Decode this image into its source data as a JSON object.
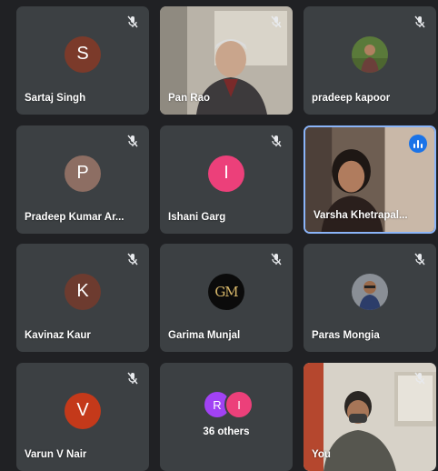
{
  "participants": [
    {
      "name": "Sartaj Singh",
      "initial": "S",
      "avatar_color": "#7b3a2a",
      "muted": true
    },
    {
      "name": "Pan Rao",
      "muted": true,
      "video": true
    },
    {
      "name": "pradeep kapoor",
      "muted": true,
      "photo": true
    },
    {
      "name": "Pradeep Kumar Ar...",
      "initial": "P",
      "avatar_color": "#8d6e63",
      "muted": true
    },
    {
      "name": "Ishani Garg",
      "initial": "I",
      "avatar_color": "#ec407a",
      "muted": true
    },
    {
      "name": "Varsha Khetrapal...",
      "muted": false,
      "speaking": true,
      "video": true
    },
    {
      "name": "Kavinaz Kaur",
      "initial": "K",
      "avatar_color": "#6d3b2f",
      "muted": true
    },
    {
      "name": "Garima Munjal",
      "initial": "GM",
      "avatar_color": "#0b0b0b",
      "muted": true
    },
    {
      "name": "Paras Mongia",
      "muted": true,
      "photo": true
    },
    {
      "name": "Varun V Nair",
      "initial": "V",
      "avatar_color": "#c4391a",
      "muted": true
    },
    {
      "name": "You",
      "muted": true,
      "video": true
    }
  ],
  "others": {
    "label": "36 others",
    "avatars": [
      {
        "initial": "R",
        "color": "#a142f4"
      },
      {
        "initial": "I",
        "color": "#ec407a"
      }
    ]
  }
}
